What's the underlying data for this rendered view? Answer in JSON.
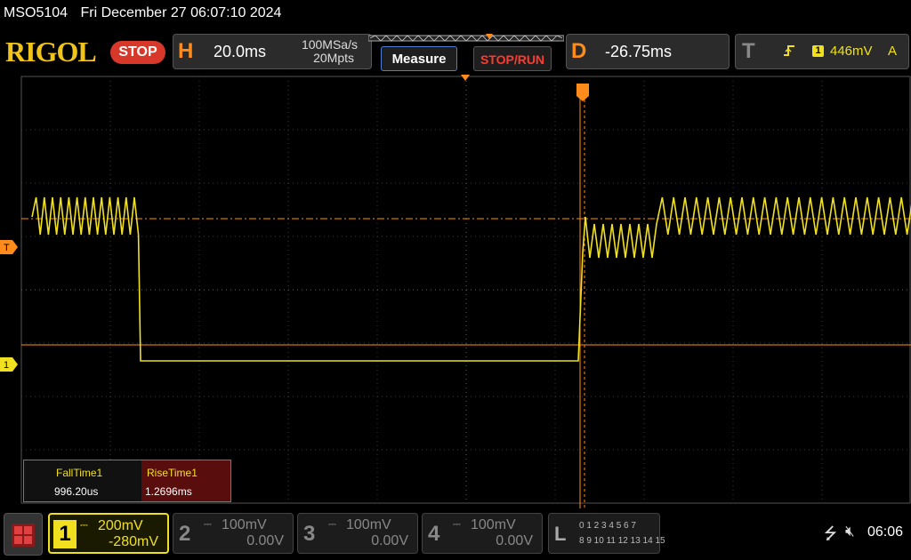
{
  "status": {
    "model": "MSO5104",
    "datetime": "Fri December 27 06:07:10 2024"
  },
  "header": {
    "logo": "RIGOL",
    "run_state": "STOP",
    "horizontal": {
      "letter": "H",
      "timebase": "20.0ms",
      "sample_rate": "100MSa/s",
      "memory_depth": "20Mpts"
    },
    "measure_label": "Measure",
    "stoprun_label": "STOP/RUN",
    "delay": {
      "letter": "D",
      "value": "-26.75ms"
    },
    "trigger": {
      "letter": "T",
      "source": "1",
      "level": "446mV",
      "mode": "A",
      "edge_icon": "rising-edge-icon"
    }
  },
  "markers": {
    "trigger_level": "T",
    "channel1": "1"
  },
  "measurements": [
    {
      "name": "FallTime1",
      "value": "996.20us"
    },
    {
      "name": "RiseTime1",
      "value": "1.2696ms"
    }
  ],
  "channels": [
    {
      "num": "1",
      "scale": "200mV",
      "offset": "-280mV",
      "active": true
    },
    {
      "num": "2",
      "scale": "100mV",
      "offset": "0.00V",
      "active": false
    },
    {
      "num": "3",
      "scale": "100mV",
      "offset": "0.00V",
      "active": false
    },
    {
      "num": "4",
      "scale": "100mV",
      "offset": "0.00V",
      "active": false
    }
  ],
  "logic": {
    "letter": "L",
    "row1": "0 1 2 3  4 5 6 7",
    "row2": "8 9 10 11 12 13 14 15"
  },
  "system": {
    "time": "06:06"
  },
  "colors": {
    "channel1": "#f0e020",
    "trigger": "#ff8c1a",
    "stop": "#d8382a"
  }
}
